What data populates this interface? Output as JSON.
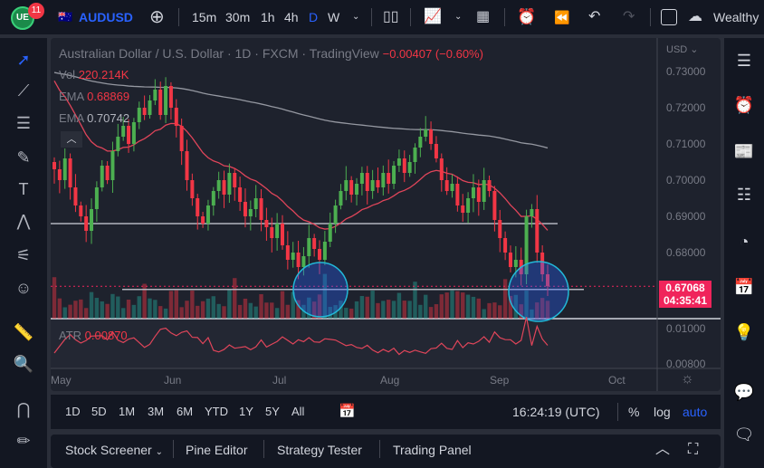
{
  "toolbar": {
    "notifications": "11",
    "symbol": "AUDUSD",
    "intervals": [
      "15m",
      "30m",
      "1h",
      "4h",
      "D",
      "W"
    ],
    "active_interval": "D",
    "account": "Wealthy"
  },
  "legend": {
    "title": "Australian Dollar / U.S. Dollar · 1D · FXCM · TradingView",
    "change": "−0.00407 (−0.60%)",
    "vol_label": "Vol",
    "vol_value": "220.214K",
    "ema1_label": "EMA",
    "ema1_value": "0.68869",
    "ema2_label": "EMA",
    "ema2_value": "0.70742",
    "atr_label": "ATR",
    "atr_value": "0.00870"
  },
  "price_axis": {
    "currency": "USD",
    "ticks": [
      "0.73000",
      "0.72000",
      "0.71000",
      "0.70000",
      "0.69000",
      "0.68000"
    ],
    "last_price": "0.67068",
    "countdown": "04:35:41",
    "atr_ticks": [
      "0.01000",
      "0.00800"
    ]
  },
  "time_axis": {
    "labels": [
      "May",
      "Jun",
      "Jul",
      "Aug",
      "Sep",
      "Oct"
    ]
  },
  "bottom_bar": {
    "ranges": [
      "1D",
      "5D",
      "1M",
      "3M",
      "6M",
      "YTD",
      "1Y",
      "5Y",
      "All"
    ],
    "clock": "16:24:19 (UTC)",
    "pct": "%",
    "log": "log",
    "auto": "auto"
  },
  "panel_tabs": [
    "Stock Screener",
    "Pine Editor",
    "Strategy Tester",
    "Trading Panel"
  ],
  "colors": {
    "up": "#26a69a",
    "up_candle": "#4caf50",
    "down": "#f23645",
    "accent": "#2962ff",
    "price_label": "#f0245b",
    "circle": "#22b8d8"
  },
  "chart_data": {
    "type": "candlestick",
    "ylim": [
      0.663,
      0.7365
    ],
    "closes": [
      0.703,
      0.7,
      0.706,
      0.698,
      0.693,
      0.69,
      0.686,
      0.692,
      0.698,
      0.704,
      0.7,
      0.708,
      0.712,
      0.715,
      0.71,
      0.716,
      0.72,
      0.718,
      0.722,
      0.725,
      0.718,
      0.726,
      0.72,
      0.715,
      0.708,
      0.7,
      0.695,
      0.69,
      0.688,
      0.693,
      0.697,
      0.7,
      0.696,
      0.702,
      0.698,
      0.694,
      0.69,
      0.692,
      0.695,
      0.689,
      0.687,
      0.684,
      0.688,
      0.682,
      0.678,
      0.68,
      0.676,
      0.679,
      0.684,
      0.681,
      0.678,
      0.683,
      0.688,
      0.693,
      0.697,
      0.7,
      0.696,
      0.699,
      0.702,
      0.697,
      0.7,
      0.698,
      0.702,
      0.699,
      0.704,
      0.706,
      0.702,
      0.705,
      0.709,
      0.712,
      0.714,
      0.71,
      0.706,
      0.7,
      0.697,
      0.699,
      0.693,
      0.691,
      0.695,
      0.698,
      0.694,
      0.7,
      0.697,
      0.689,
      0.684,
      0.68,
      0.676,
      0.678,
      0.674,
      0.69,
      0.692,
      0.68,
      0.674,
      0.6707
    ],
    "horizontal_levels": [
      0.688,
      0.6698
    ]
  }
}
